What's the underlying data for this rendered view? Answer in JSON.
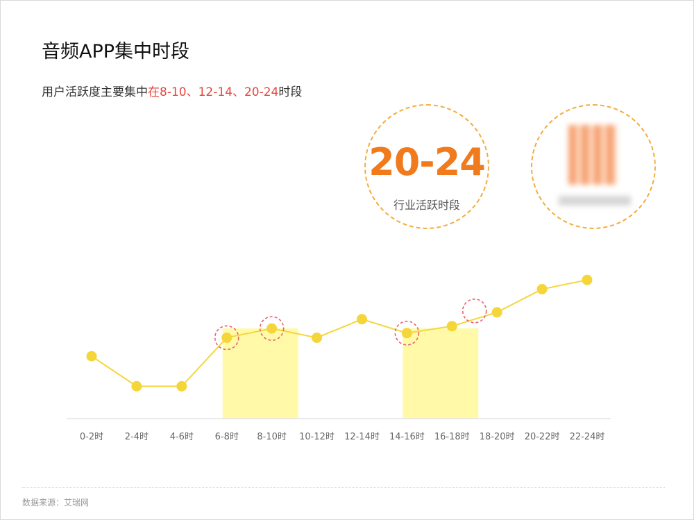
{
  "title": "音频APP集中时段",
  "subtitle": {
    "prefix": "用户活跃度主要集中",
    "highlight": "在8-10、12-14、20-24",
    "suffix": "时段"
  },
  "stat": {
    "value": "20-24",
    "label": "行业活跃时段"
  },
  "source": "数据来源：艾瑞网",
  "colors": {
    "accent_orange": "#f07a1c",
    "highlight_red": "#e8453c",
    "line_yellow": "#f5d63a",
    "band_yellow": "#fff9a8",
    "circle_dash": "#f3ad3f"
  },
  "chart_data": {
    "type": "line",
    "categories": [
      "0-2时",
      "2-4时",
      "4-6时",
      "6-8时",
      "8-10时",
      "10-12时",
      "12-14时",
      "14-16时",
      "16-18时",
      "18-20时",
      "20-22时",
      "22-24时"
    ],
    "values": [
      0.27,
      0.14,
      0.14,
      0.35,
      0.39,
      0.35,
      0.43,
      0.37,
      0.4,
      0.46,
      0.56,
      0.6
    ],
    "ylim": [
      0,
      1
    ],
    "highlight_bands": [
      [
        "6-8时",
        "8-10时"
      ],
      [
        "14-16时",
        "16-18时"
      ]
    ],
    "band_level": 0.39,
    "circled_points": [
      "6-8时",
      "8-10时",
      "14-16时"
    ],
    "extra_circle_between": [
      "16-18时",
      "18-20时"
    ],
    "grid": false,
    "legend": "none"
  }
}
